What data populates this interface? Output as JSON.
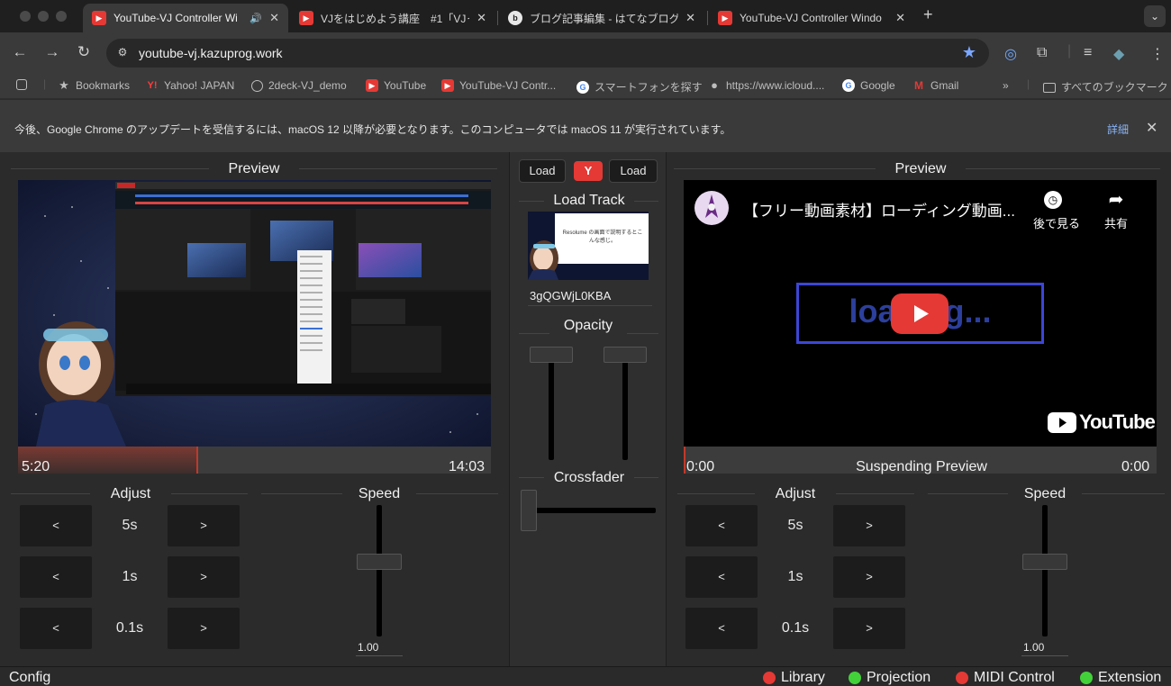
{
  "browser": {
    "tabs": [
      {
        "title": "YouTube-VJ Controller Wi",
        "favicon": "youtube-icon",
        "active": true,
        "audio": true
      },
      {
        "title": "VJをはじめよう講座　#1「VJっ",
        "favicon": "youtube-icon",
        "active": false
      },
      {
        "title": "ブログ記事編集 - はてなブログ",
        "favicon": "hatena-icon",
        "active": false
      },
      {
        "title": "YouTube-VJ Controller Windo",
        "favicon": "youtube-icon",
        "active": false
      }
    ],
    "url": "youtube-vj.kazuprog.work",
    "bookmarks": [
      {
        "label": "Bookmarks",
        "icon": "star-icon"
      },
      {
        "label": "Yahoo! JAPAN",
        "icon": "yahoo-icon"
      },
      {
        "label": "2deck-VJ_demo",
        "icon": "globe-icon"
      },
      {
        "label": "YouTube",
        "icon": "youtube-icon"
      },
      {
        "label": "YouTube-VJ Contr...",
        "icon": "youtube-icon"
      },
      {
        "label": "スマートフォンを探す",
        "icon": "google-icon"
      },
      {
        "label": "https://www.icloud....",
        "icon": "apple-icon"
      },
      {
        "label": "Google",
        "icon": "google-icon"
      },
      {
        "label": "Gmail",
        "icon": "gmail-icon"
      }
    ],
    "bookmarks_overflow": "»",
    "all_bookmarks": "すべてのブックマーク",
    "infobar": {
      "message": "今後、Google Chrome のアップデートを受信するには、macOS 12 以降が必要となります。このコンピュータでは macOS 11 が実行されています。",
      "link": "詳細",
      "close": "✕"
    }
  },
  "left_deck": {
    "preview_title": "Preview",
    "current_time": "5:20",
    "duration": "14:03",
    "progress": 0.38,
    "adjust_title": "Adjust",
    "speed_title": "Speed",
    "adjust_rows": [
      {
        "label": "5s",
        "back": "<",
        "fwd": ">"
      },
      {
        "label": "1s",
        "back": "<",
        "fwd": ">"
      },
      {
        "label": "0.1s",
        "back": "<",
        "fwd": ">"
      }
    ],
    "speed_value": "1.00"
  },
  "mixer": {
    "load_left": "Load",
    "youtube_button": "Y",
    "load_right": "Load",
    "load_track_title": "Load Track",
    "track_id": "3gQGWjL0KBA",
    "thumbnail_caption": "Resolume の画面で説明するとこんな感じ。",
    "opacity_title": "Opacity",
    "opacity_left": 1.0,
    "opacity_right": 1.0,
    "crossfader_title": "Crossfader",
    "crossfader_position": 0.0
  },
  "right_deck": {
    "preview_title": "Preview",
    "video_title": "【フリー動画素材】ローディング動画...",
    "watch_later": "後で見る",
    "share": "共有",
    "loading_text": "loading...",
    "youtube_brand": "YouTube",
    "current_time": "0:00",
    "status": "Suspending Preview",
    "duration": "0:00",
    "progress": 0.0,
    "adjust_title": "Adjust",
    "speed_title": "Speed",
    "adjust_rows": [
      {
        "label": "5s",
        "back": "<",
        "fwd": ">"
      },
      {
        "label": "1s",
        "back": "<",
        "fwd": ">"
      },
      {
        "label": "0.1s",
        "back": "<",
        "fwd": ">"
      }
    ],
    "speed_value": "1.00"
  },
  "statusbar": {
    "config": "Config",
    "indicators": [
      {
        "label": "Library",
        "color": "#e53935"
      },
      {
        "label": "Projection",
        "color": "#43d13a"
      },
      {
        "label": "MIDI Control",
        "color": "#e53935"
      },
      {
        "label": "Extension",
        "color": "#43d13a"
      }
    ]
  }
}
